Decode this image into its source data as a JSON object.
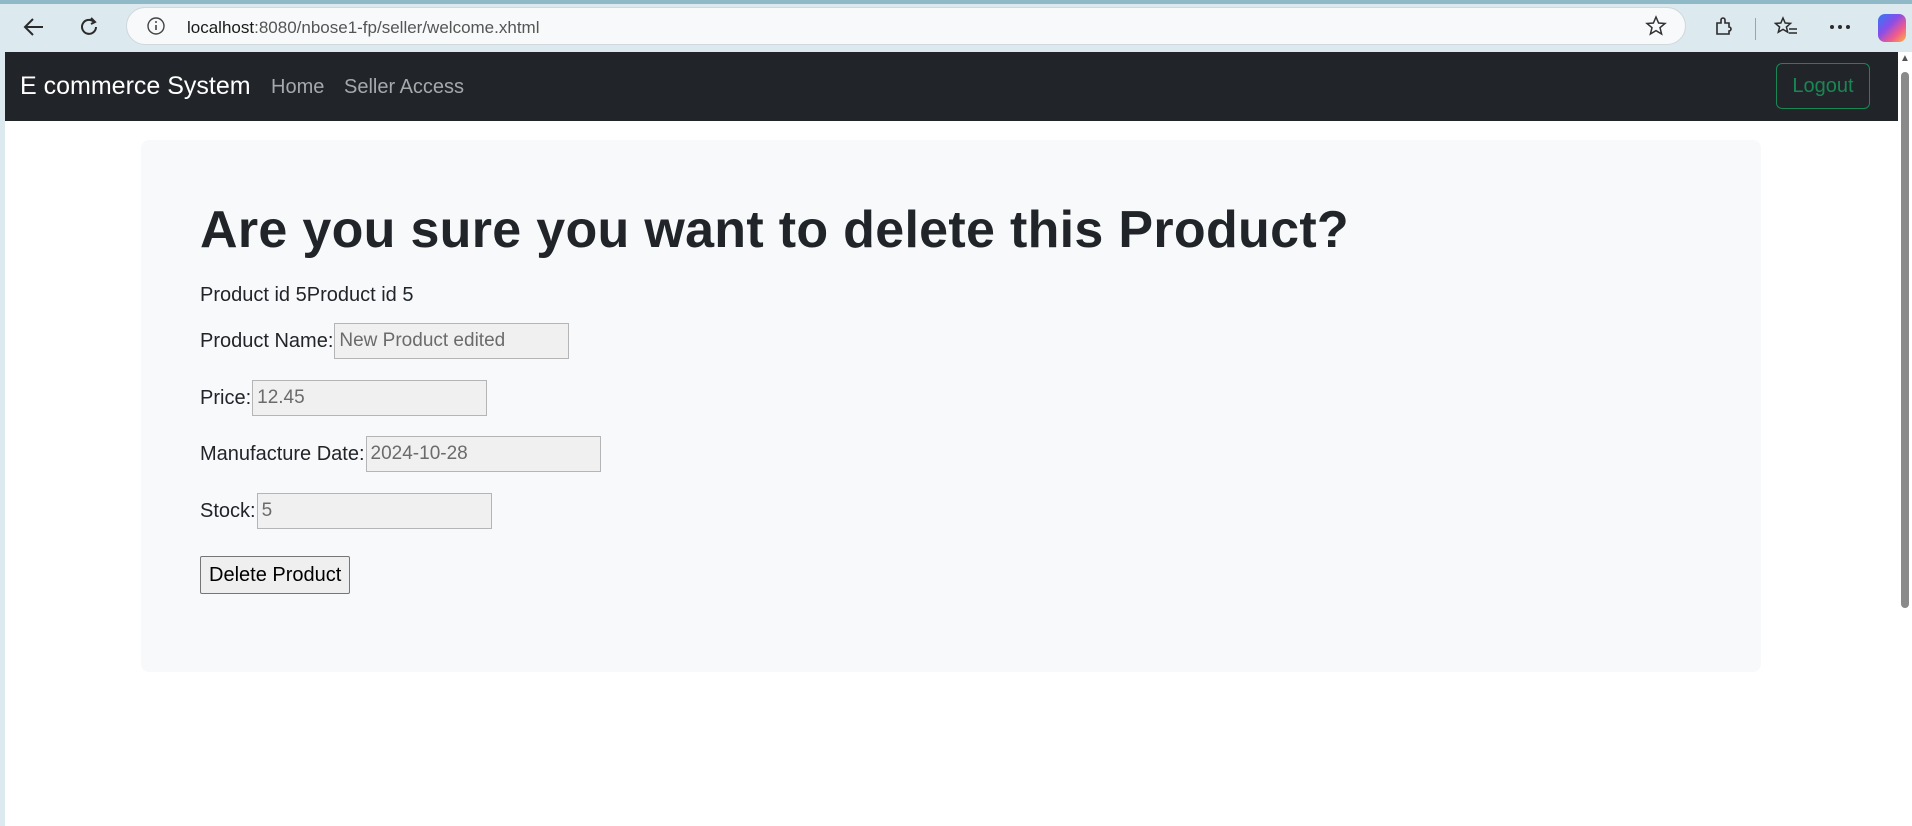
{
  "browser": {
    "url_host": "localhost",
    "url_rest": ":8080/nbose1-fp/seller/welcome.xhtml"
  },
  "navbar": {
    "brand": "E commerce System",
    "links": [
      "Home",
      "Seller Access"
    ],
    "logout_label": "Logout",
    "logout_color": "#198754"
  },
  "main": {
    "heading": "Are you sure you want to delete this Product?",
    "product_id_text": "Product id 5Product id 5",
    "fields": {
      "name": {
        "label": "Product Name:",
        "value": "New Product edited"
      },
      "price": {
        "label": "Price:",
        "value": "12.45"
      },
      "manufacture_date": {
        "label": "Manufacture Date:",
        "value": "2024-10-28"
      },
      "stock": {
        "label": "Stock:",
        "value": "5"
      }
    },
    "delete_button_label": "Delete Product"
  }
}
